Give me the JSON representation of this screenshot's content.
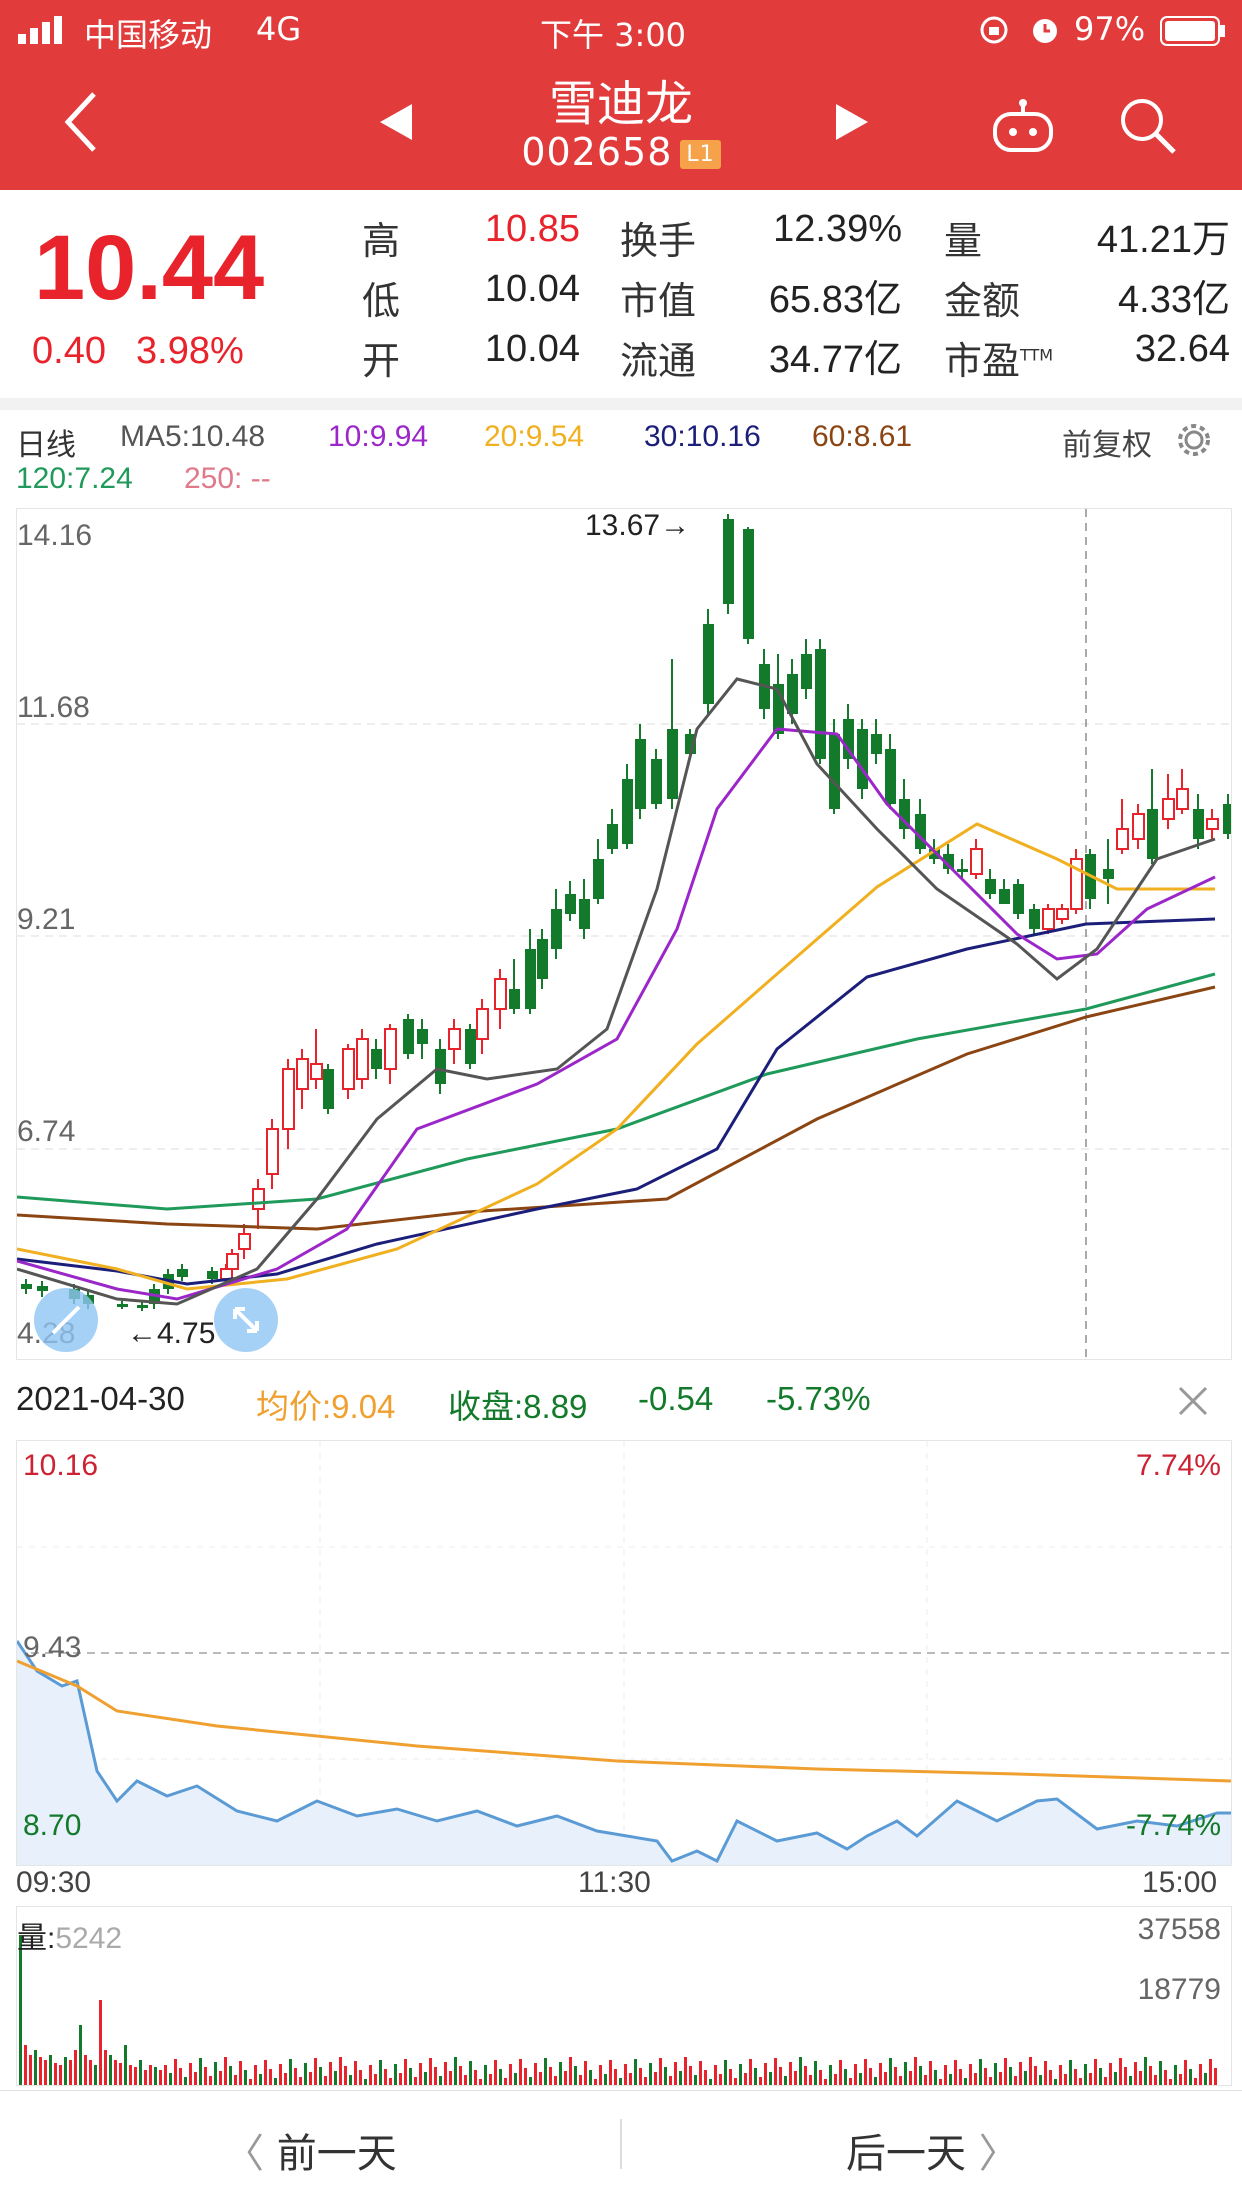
{
  "status": {
    "carrier": "中国移动",
    "network": "4G",
    "time": "下午 3:00",
    "battery": "97%"
  },
  "header": {
    "title": "雪迪龙",
    "code": "002658",
    "level_badge": "L1"
  },
  "quote": {
    "price": "10.44",
    "change": "0.40",
    "change_pct": "3.98%",
    "fields": [
      {
        "label": "高",
        "value": "10.85",
        "color": "#e8232b"
      },
      {
        "label": "低",
        "value": "10.04",
        "color": "#222222"
      },
      {
        "label": "开",
        "value": "10.04",
        "color": "#222222"
      },
      {
        "label": "换手",
        "value": "12.39%",
        "color": "#222222"
      },
      {
        "label": "市值",
        "value": "65.83亿",
        "color": "#222222"
      },
      {
        "label": "流通",
        "value": "34.77亿",
        "color": "#222222"
      },
      {
        "label": "量",
        "value": "41.21万",
        "color": "#222222"
      },
      {
        "label": "金额",
        "value": "4.33亿",
        "color": "#222222"
      },
      {
        "label": "市盈",
        "sup": "TTM",
        "value": "32.64",
        "color": "#222222"
      }
    ]
  },
  "kline_header": {
    "period": "日线",
    "ma": [
      {
        "text": "MA5:10.48",
        "color": "#555555"
      },
      {
        "text": "10:9.94",
        "color": "#9b27c9"
      },
      {
        "text": "20:9.54",
        "color": "#f0b020"
      },
      {
        "text": "30:10.16",
        "color": "#1c1f7a"
      },
      {
        "text": "60:8.61",
        "color": "#8b4513"
      },
      {
        "text": "120:7.24",
        "color": "#1f9a5a"
      },
      {
        "text": "250: --",
        "color": "#e07a8a"
      }
    ],
    "adjust": "前复权"
  },
  "kline": {
    "y_labels": [
      "14.16",
      "11.68",
      "9.21",
      "6.74",
      "4.28"
    ],
    "max_label": "13.67→",
    "min_label": "←4.75"
  },
  "intraday_info": {
    "date": "2021-04-30",
    "avg": "均价:9.04",
    "close": "收盘:8.89",
    "chg": "-0.54",
    "chg_pct": "-5.73%"
  },
  "intraday": {
    "y_top": "10.16",
    "y_mid": "9.43",
    "y_bot": "8.70",
    "pct_top": "7.74%",
    "pct_bot": "-7.74%",
    "times": [
      "09:30",
      "11:30",
      "15:00"
    ]
  },
  "volume": {
    "label": "量:",
    "value": "5242",
    "max": "37558",
    "mid": "18779"
  },
  "nav": {
    "prev": "前一天",
    "next": "后一天"
  },
  "colors": {
    "brand": "#e23b3b",
    "up": "#e8232b",
    "down": "#127a2a"
  }
}
